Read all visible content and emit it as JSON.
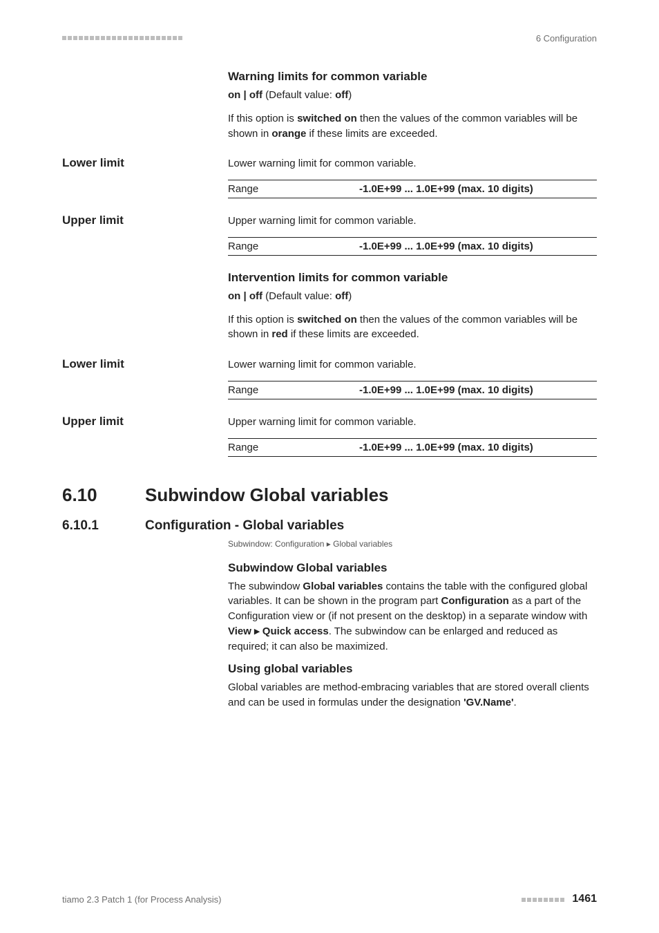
{
  "header": {
    "right": "6 Configuration"
  },
  "s1": {
    "title": "Warning limits for common variable",
    "default_line_prefix": "on | off",
    "default_line_mid": " (Default value: ",
    "default_line_val": "off",
    "default_line_suffix": ")",
    "desc_a": "If this option is ",
    "desc_b": "switched on",
    "desc_c": " then the values of the common variables will be shown in ",
    "desc_d": "orange",
    "desc_e": " if these limits are exceeded."
  },
  "lower1": {
    "label": "Lower limit",
    "desc": "Lower warning limit for common variable.",
    "range_lbl": "Range",
    "range_val": "-1.0E+99 ... 1.0E+99 (max. 10 digits)"
  },
  "upper1": {
    "label": "Upper limit",
    "desc": "Upper warning limit for common variable.",
    "range_lbl": "Range",
    "range_val": "-1.0E+99 ... 1.0E+99 (max. 10 digits)"
  },
  "s2": {
    "title": "Intervention limits for common variable",
    "default_line_prefix": "on | off",
    "default_line_mid": " (Default value: ",
    "default_line_val": "off",
    "default_line_suffix": ")",
    "desc_a": "If this option is ",
    "desc_b": "switched on",
    "desc_c": " then the values of the common variables will be shown in ",
    "desc_d": "red",
    "desc_e": " if these limits are exceeded."
  },
  "lower2": {
    "label": "Lower limit",
    "desc": "Lower warning limit for common variable.",
    "range_lbl": "Range",
    "range_val": "-1.0E+99 ... 1.0E+99 (max. 10 digits)"
  },
  "upper2": {
    "label": "Upper limit",
    "desc": "Upper warning limit for common variable.",
    "range_lbl": "Range",
    "range_val": "-1.0E+99 ... 1.0E+99 (max. 10 digits)"
  },
  "section": {
    "num": "6.10",
    "title": "Subwindow Global variables"
  },
  "subsection": {
    "num": "6.10.1",
    "title": "Configuration - Global variables",
    "breadcrumb": "Subwindow: Configuration ▸ Global variables"
  },
  "gv": {
    "h1": "Subwindow Global variables",
    "p1_a": "The subwindow ",
    "p1_b": "Global variables",
    "p1_c": " contains the table with the configured global variables. It can be shown in the program part ",
    "p1_d": "Configuration",
    "p1_e": " as a part of the Configuration view or (if not present on the desktop) in a separate window with ",
    "p1_f": "View ▸ Quick access",
    "p1_g": ". The subwindow can be enlarged and reduced as required; it can also be maximized.",
    "h2": "Using global variables",
    "p2_a": "Global variables are method-embracing variables that are stored overall clients and can be used in formulas under the designation ",
    "p2_b": "'GV.Name'",
    "p2_c": "."
  },
  "footer": {
    "left": "tiamo 2.3 Patch 1 (for Process Analysis)",
    "page": "1461"
  }
}
